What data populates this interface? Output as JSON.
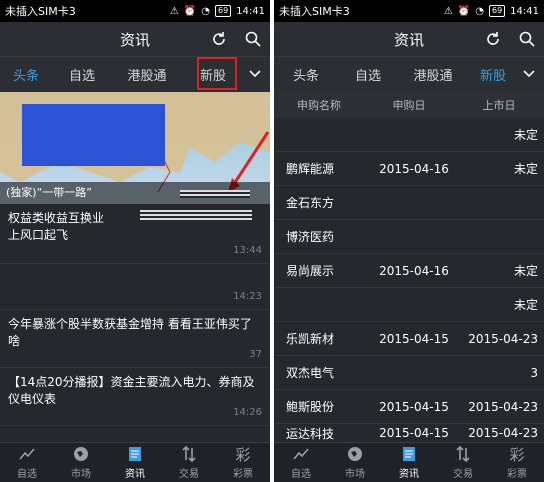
{
  "status": {
    "carrier": "未插入SIM卡3",
    "battery": "69",
    "time": "14:41"
  },
  "header": {
    "title": "资讯"
  },
  "tabs": [
    "头条",
    "自选",
    "港股通",
    "新股"
  ],
  "left": {
    "banner_caption": "(独家)“一带一路”",
    "news": [
      {
        "title": "权益类收益互换业\n上风口起飞",
        "time": "13:44"
      },
      {
        "title": "",
        "time": "14:23"
      },
      {
        "title": "今年暴涨个股半数获基金增持 看看王亚伟买了啥",
        "time": "37"
      },
      {
        "title": "【14点20分播报】资金主要流入电力、券商及仪电仪表",
        "time": "14:26"
      }
    ]
  },
  "right": {
    "table_headers": [
      "申购名称",
      "申购日",
      "上市日"
    ],
    "rows": [
      {
        "name": "",
        "apply": "",
        "list": "未定"
      },
      {
        "name": "鹏辉能源",
        "apply": "2015-04-16",
        "list": "未定"
      },
      {
        "name": "金石东方",
        "apply": "",
        "list": ""
      },
      {
        "name": "博济医药",
        "apply": "",
        "list": ""
      },
      {
        "name": "易尚展示",
        "apply": "2015-04-16",
        "list": "未定"
      },
      {
        "name": "",
        "apply": "",
        "list": "未定"
      },
      {
        "name": "乐凯新材",
        "apply": "2015-04-15",
        "list": "2015-04-23"
      },
      {
        "name": "双杰电气",
        "apply": "",
        "list": "3"
      },
      {
        "name": "鲍斯股份",
        "apply": "2015-04-15",
        "list": "2015-04-23"
      },
      {
        "name": "运达科技",
        "apply": "2015-04-15",
        "list": "2015-04-23"
      }
    ]
  },
  "tabbar": [
    "自选",
    "市场",
    "资讯",
    "交易",
    "彩票"
  ],
  "colors": {
    "accent": "#3f9be0",
    "highlight": "#e02020",
    "background": "#25282c"
  }
}
